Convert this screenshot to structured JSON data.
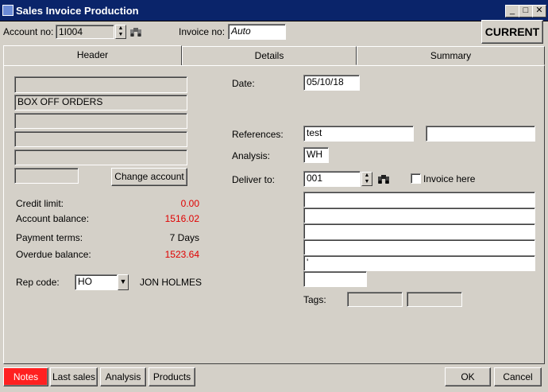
{
  "window": {
    "title": "Sales Invoice Production"
  },
  "top": {
    "account_label": "Account no:",
    "account_value": "1I004",
    "invoice_label": "Invoice no:",
    "invoice_value": "Auto",
    "current_label": "CURRENT"
  },
  "tabs": [
    {
      "label": "Header"
    },
    {
      "label": "Details"
    },
    {
      "label": "Summary"
    }
  ],
  "customer": {
    "address_lines": [
      "",
      "BOX OFF ORDERS",
      "",
      "",
      ""
    ],
    "change_account_label": "Change account"
  },
  "financials": [
    {
      "label": "Credit limit:",
      "value": "0.00",
      "color": "#e00000"
    },
    {
      "label": "Account balance:",
      "value": "1516.02",
      "color": "#e00000"
    },
    {
      "label": "Payment terms:",
      "value": "7 Days",
      "color": "#000000"
    },
    {
      "label": "Overdue balance:",
      "value": "1523.64",
      "color": "#e00000"
    }
  ],
  "rep": {
    "label": "Rep code:",
    "value": "HO",
    "name": "JON HOLMES"
  },
  "right_form": {
    "date_label": "Date:",
    "date_value": "05/10/18",
    "references_label": "References:",
    "reference1": "test",
    "reference2": "",
    "analysis_label": "Analysis:",
    "analysis_value": "WH",
    "deliver_label": "Deliver to:",
    "deliver_value": "001",
    "invoice_here_label": "Invoice here",
    "invoice_here_checked": false,
    "delivery_lines": [
      "",
      "",
      "",
      "",
      "'"
    ],
    "tags_label": "Tags:"
  },
  "bottom": {
    "notes": "Notes",
    "last_sales": "Last sales",
    "analysis": "Analysis",
    "products": "Products",
    "ok": "OK",
    "cancel": "Cancel"
  }
}
